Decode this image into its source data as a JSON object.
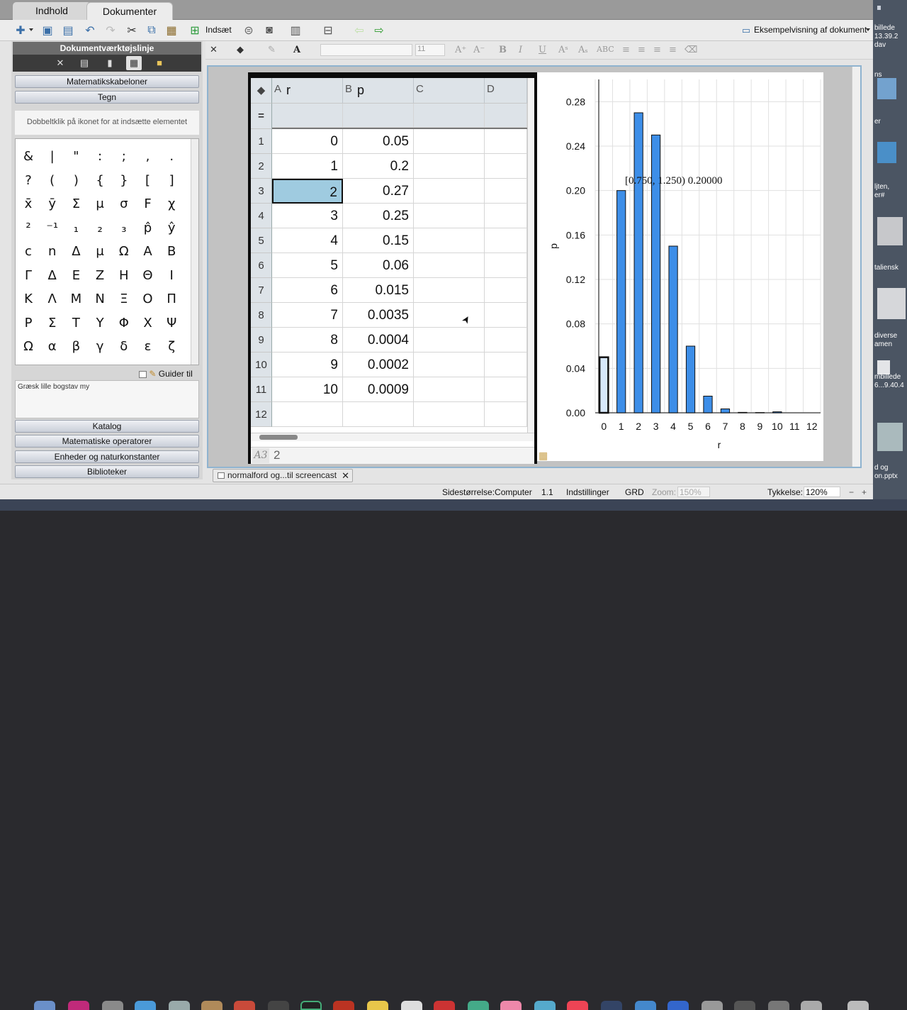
{
  "tabs": {
    "indhold": "Indhold",
    "dokumenter": "Dokumenter"
  },
  "toolbar": {
    "insert_label": "Indsæt",
    "preview_label": "Eksempelvisning af dokument"
  },
  "left_panel": {
    "title": "Dokumentværktøjslinje",
    "sections": {
      "math_templates": "Matematikskabeloner",
      "draw": "Tegn",
      "catalog": "Katalog",
      "math_operators": "Matematiske operatorer",
      "units": "Enheder og naturkonstanter",
      "libraries": "Biblioteker"
    },
    "hint": "Dobbeltklik på ikonet for at indsætte elementet",
    "symbols": [
      [
        "&",
        "|",
        "\"",
        ":",
        ";",
        ",",
        "."
      ],
      [
        "?",
        "(",
        ")",
        "{",
        "}",
        "[",
        "]"
      ],
      [
        "x̄",
        "ȳ",
        "Σ",
        "μ",
        "σ",
        "F",
        "χ"
      ],
      [
        "²",
        "⁻¹",
        "₁",
        "₂",
        "₃",
        "p̂",
        "ŷ"
      ],
      [
        "c",
        "n",
        "Δ",
        "μ",
        "Ω",
        "A",
        "B"
      ],
      [
        "Γ",
        "Δ",
        "E",
        "Z",
        "H",
        "Θ",
        "I"
      ],
      [
        "K",
        "Λ",
        "M",
        "N",
        "Ξ",
        "O",
        "Π"
      ],
      [
        "P",
        "Σ",
        "T",
        "Y",
        "Φ",
        "X",
        "Ψ"
      ],
      [
        "Ω",
        "α",
        "β",
        "γ",
        "δ",
        "ε",
        "ζ"
      ]
    ],
    "guider_label": "Guider til",
    "description": "Græsk lille bogstav my"
  },
  "format_bar": {
    "font_size": "11"
  },
  "spreadsheet": {
    "columns": [
      {
        "letter": "A",
        "name": "r"
      },
      {
        "letter": "B",
        "name": "p"
      },
      {
        "letter": "C",
        "name": ""
      },
      {
        "letter": "D",
        "name": ""
      }
    ],
    "rows": [
      {
        "n": "1",
        "r": "0",
        "p": "0.05"
      },
      {
        "n": "2",
        "r": "1",
        "p": "0.2"
      },
      {
        "n": "3",
        "r": "2",
        "p": "0.27"
      },
      {
        "n": "4",
        "r": "3",
        "p": "0.25"
      },
      {
        "n": "5",
        "r": "4",
        "p": "0.15"
      },
      {
        "n": "6",
        "r": "5",
        "p": "0.06"
      },
      {
        "n": "7",
        "r": "6",
        "p": "0.015"
      },
      {
        "n": "8",
        "r": "7",
        "p": "0.0035"
      },
      {
        "n": "9",
        "r": "8",
        "p": "0.0004"
      },
      {
        "n": "10",
        "r": "9",
        "p": "0.0002"
      },
      {
        "n": "11",
        "r": "10",
        "p": "0.0009"
      },
      {
        "n": "12",
        "r": "",
        "p": ""
      }
    ],
    "cell_ref": "A3",
    "cell_value": "2"
  },
  "chart_data": {
    "type": "bar",
    "categories": [
      "0",
      "1",
      "2",
      "3",
      "4",
      "5",
      "6",
      "7",
      "8",
      "9",
      "10",
      "11",
      "12"
    ],
    "values": [
      0.05,
      0.2,
      0.27,
      0.25,
      0.15,
      0.06,
      0.015,
      0.0035,
      0.0004,
      0.0002,
      0.0009,
      0,
      0
    ],
    "xlabel": "r",
    "ylabel": "p",
    "yticks": [
      "0.00",
      "0.04",
      "0.08",
      "0.12",
      "0.16",
      "0.20",
      "0.24",
      "0.28"
    ],
    "ylim": [
      0,
      0.3
    ],
    "annotation": "[0.750, 1.250) 0.20000",
    "bar_color": "#3d8ee8",
    "selected_bar_color": "#d7e8fb"
  },
  "doc_tab": "normalford og...til screencast",
  "status": {
    "page_size": "Sidestørrelse:Computer",
    "page": "1.1",
    "settings": "Indstillinger",
    "mode": "GRD",
    "zoom_label": "Zoom:",
    "zoom_value": "150%",
    "thickness_label": "Tykkelse:",
    "thickness_value": "120%"
  },
  "desktop_labels": [
    "billede",
    "13.39.2",
    "dav",
    "ns",
    "er",
    "ljten,",
    "er#",
    "taliensk",
    "diverse",
    "amen",
    "mbillede",
    "6...9.40.4",
    "d og",
    "on.pptx"
  ]
}
